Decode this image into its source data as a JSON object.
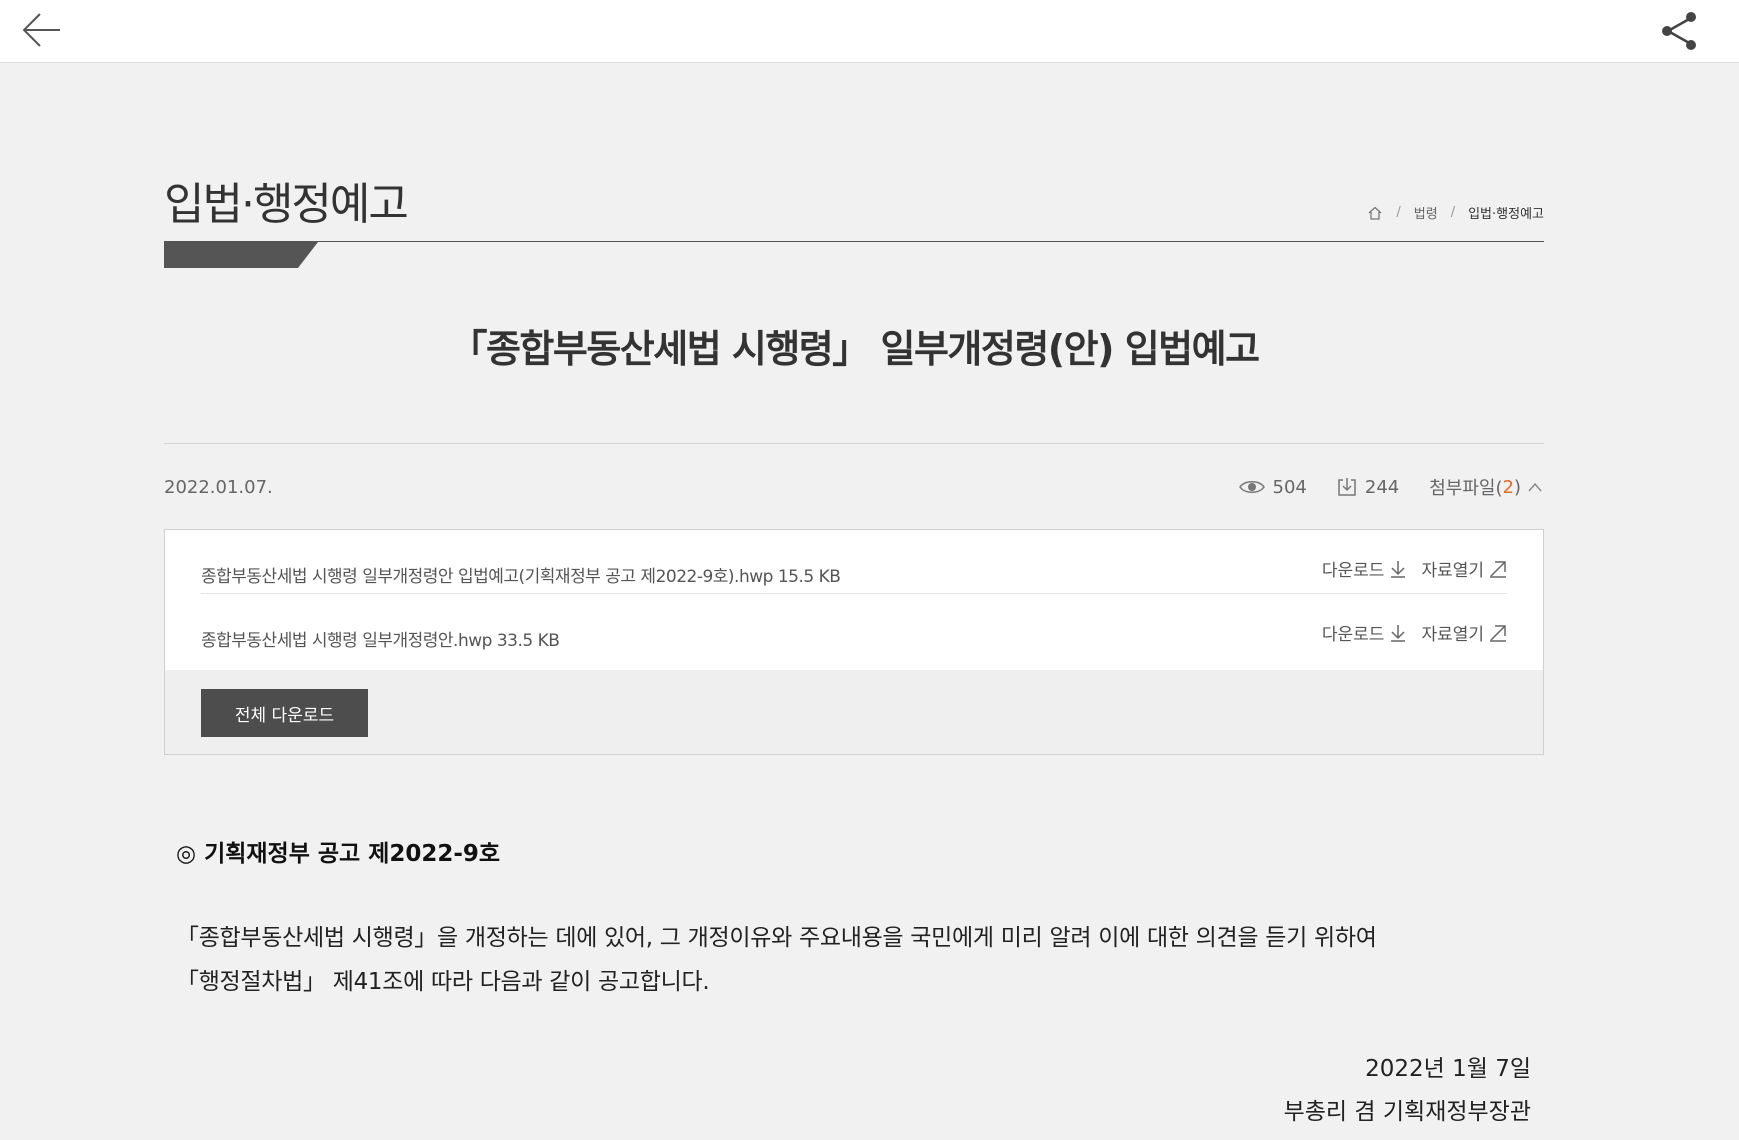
{
  "page": {
    "title": "입법·행정예고"
  },
  "breadcrumb": {
    "items": [
      "법령",
      "입법·행정예고"
    ]
  },
  "article": {
    "title": "「종합부동산세법 시행령」 일부개정령(안) 입법예고",
    "date": "2022.01.07.",
    "views": "504",
    "downloads": "244",
    "attachments_label": "첨부파일(",
    "attachments_count": "2",
    "attachments_close": ")"
  },
  "attachments": [
    {
      "name": "종합부동산세법 시행령 일부개정령안 입법예고(기획재정부 공고 제2022-9호).hwp 15.5 KB",
      "download_label": "다운로드",
      "open_label": "자료열기"
    },
    {
      "name": "종합부동산세법 시행령 일부개정령안.hwp 33.5 KB",
      "download_label": "다운로드",
      "open_label": "자료열기"
    }
  ],
  "download_all_label": "전체 다운로드",
  "body": {
    "heading": "◎ 기획재정부 공고 제2022-9호",
    "line1": "「종합부동산세법 시행령」을 개정하는 데에 있어, 그 개정이유와 주요내용을 국민에게 미리 알려 이에 대한 의견을 듣기 위하여",
    "line2": "「행정절차법」 제41조에 따라 다음과 같이 공고합니다.",
    "sign_date": "2022년 1월 7일",
    "sign_name": "부총리 겸 기획재정부장관"
  },
  "icons": {
    "back": "back-arrow-icon",
    "share": "share-icon",
    "home": "home-icon",
    "views": "eye-icon",
    "downloads": "download-box-icon",
    "toggle": "chevron-up-icon"
  },
  "colors": {
    "accent": "#e86a1e",
    "dark_button": "#4d4d4d",
    "background": "#f1f1f1"
  }
}
